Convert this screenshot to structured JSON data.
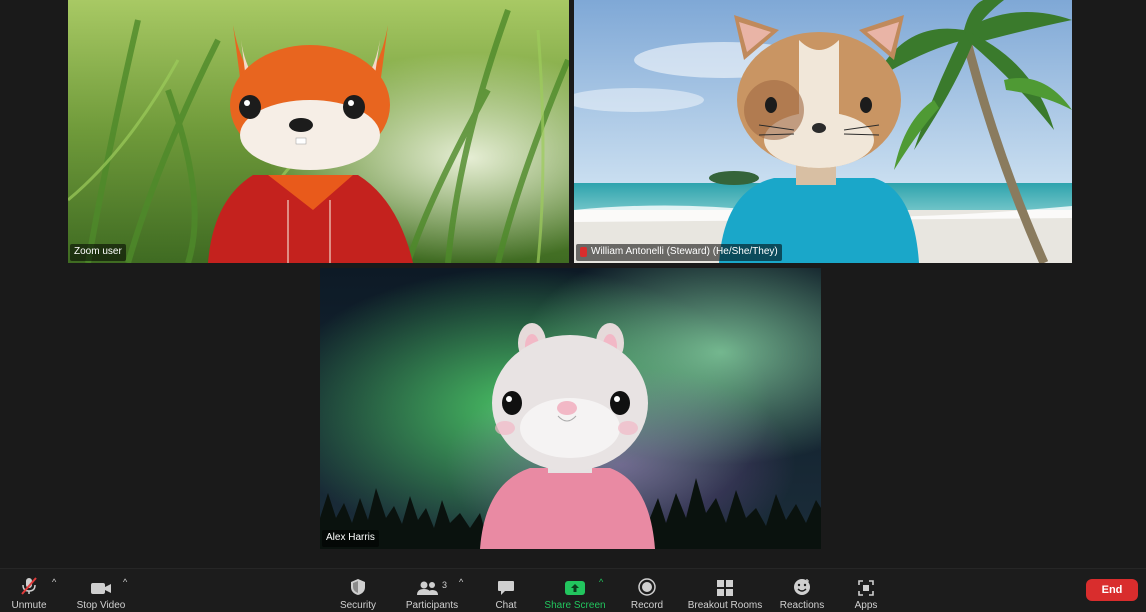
{
  "participants": [
    {
      "name": "Zoom user"
    },
    {
      "name": "William Antonelli (Steward) (He/She/They)"
    },
    {
      "name": "Alex Harris"
    }
  ],
  "toolbar": {
    "unmute": "Unmute",
    "stop_video": "Stop Video",
    "security": "Security",
    "participants": "Participants",
    "participant_count": "3",
    "chat": "Chat",
    "share_screen": "Share Screen",
    "record": "Record",
    "breakout_rooms": "Breakout Rooms",
    "reactions": "Reactions",
    "apps": "Apps",
    "end": "End"
  },
  "colors": {
    "active_speaker_border": "#2fb344",
    "share_green": "#22c55e",
    "end_red": "#d92d2d",
    "mute_red": "#d92d2d"
  }
}
